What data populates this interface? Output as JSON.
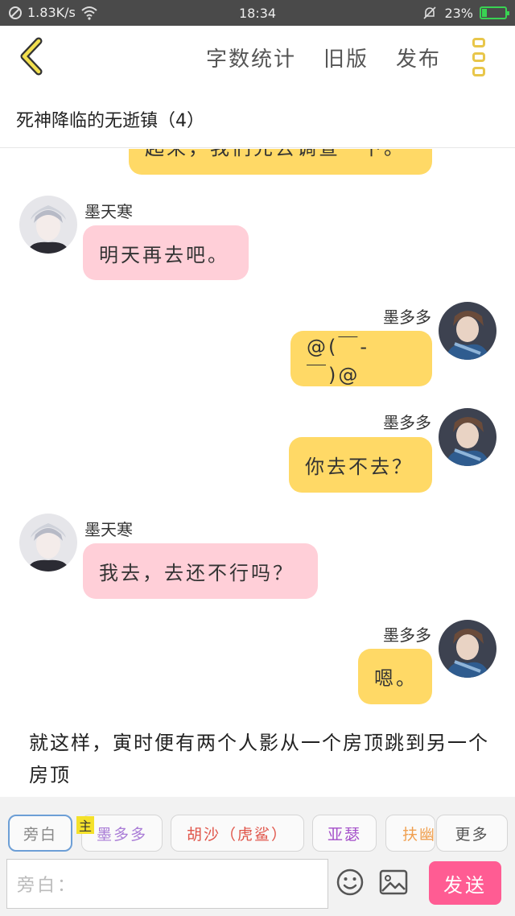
{
  "status_bar": {
    "network_speed": "1.83K/s",
    "time": "18:34",
    "battery_percent": "23%",
    "battery_level": 0.23
  },
  "toolbar": {
    "word_count_label": "字数统计",
    "old_version_label": "旧版",
    "publish_label": "发布"
  },
  "story": {
    "title": "死神降临的无逝镇（4）"
  },
  "messages": [
    {
      "side": "right",
      "speaker": "",
      "text": "起来，我们先去调查一下。",
      "color": "#ffd966"
    },
    {
      "side": "left",
      "speaker": "墨天寒",
      "text": "明天再去吧。",
      "color": "#ffcfd8"
    },
    {
      "side": "right",
      "speaker": "墨多多",
      "text": "@(￣-￣)@",
      "color": "#ffd966"
    },
    {
      "side": "right",
      "speaker": "墨多多",
      "text": "你去不去？",
      "color": "#ffd966"
    },
    {
      "side": "left",
      "speaker": "墨天寒",
      "text": "我去，去还不行吗？",
      "color": "#ffcfd8"
    },
    {
      "side": "right",
      "speaker": "墨多多",
      "text": "嗯。",
      "color": "#ffd966"
    }
  ],
  "narration": "就这样，寅时便有两个人影从一个房顶跳到另一个房顶",
  "role_chips": [
    {
      "label": "旁白",
      "color": "#888888"
    },
    {
      "label": "墨多多",
      "color": "#a97cd6"
    },
    {
      "label": "胡沙（虎鲨）",
      "color": "#e0554a"
    },
    {
      "label": "亚瑟",
      "color": "#a44fc9"
    },
    {
      "label": "扶幽",
      "color": "#f0a050"
    }
  ],
  "main_role_tag": "主",
  "more_label": "更多",
  "input": {
    "placeholder": "旁白："
  },
  "send_label": "发送",
  "icons": {
    "back": "chevron-left-icon",
    "menu": "menu-dots-icon",
    "emoji": "smiley-icon",
    "image": "image-icon"
  },
  "colors": {
    "accent_yellow": "#ffd966",
    "pink_bubble": "#ffcfd8",
    "send_button": "#ff5c93",
    "icon_yellow": "#e8c64a"
  }
}
